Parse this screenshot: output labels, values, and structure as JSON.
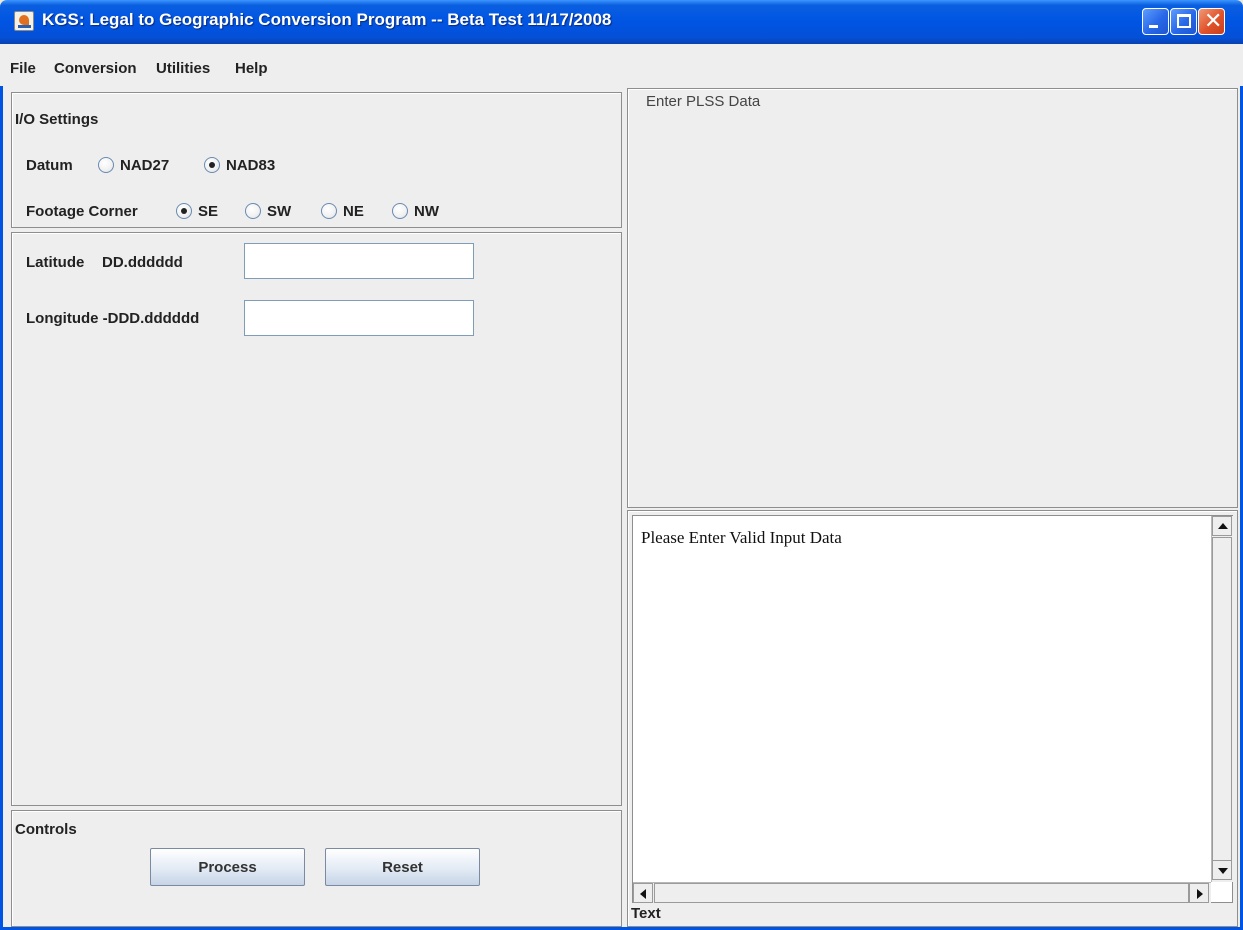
{
  "window": {
    "title": "KGS: Legal to Geographic Conversion Program -- Beta Test 11/17/2008"
  },
  "menu": {
    "items": [
      "File",
      "Conversion",
      "Utilities",
      "Help"
    ]
  },
  "io_settings": {
    "title": "I/O Settings",
    "datum": {
      "label": "Datum",
      "options": [
        "NAD27",
        "NAD83"
      ],
      "selected": "NAD83"
    },
    "footage_corner": {
      "label": "Footage Corner",
      "options": [
        "SE",
        "SW",
        "NE",
        "NW"
      ],
      "selected": "SE"
    }
  },
  "coordinates": {
    "latitude_label": "Latitude",
    "latitude_format": "DD.dddddd",
    "latitude_value": "",
    "longitude_label": "Longitude -DDD.dddddd",
    "longitude_value": ""
  },
  "controls": {
    "title": "Controls",
    "process_label": "Process",
    "reset_label": "Reset"
  },
  "plss": {
    "title": "Enter PLSS Data"
  },
  "console": {
    "message": "Please Enter Valid Input Data",
    "footer_label": "Text"
  },
  "colors": {
    "titlebar": "#0054e3",
    "window_bg": "#eeeeee"
  }
}
